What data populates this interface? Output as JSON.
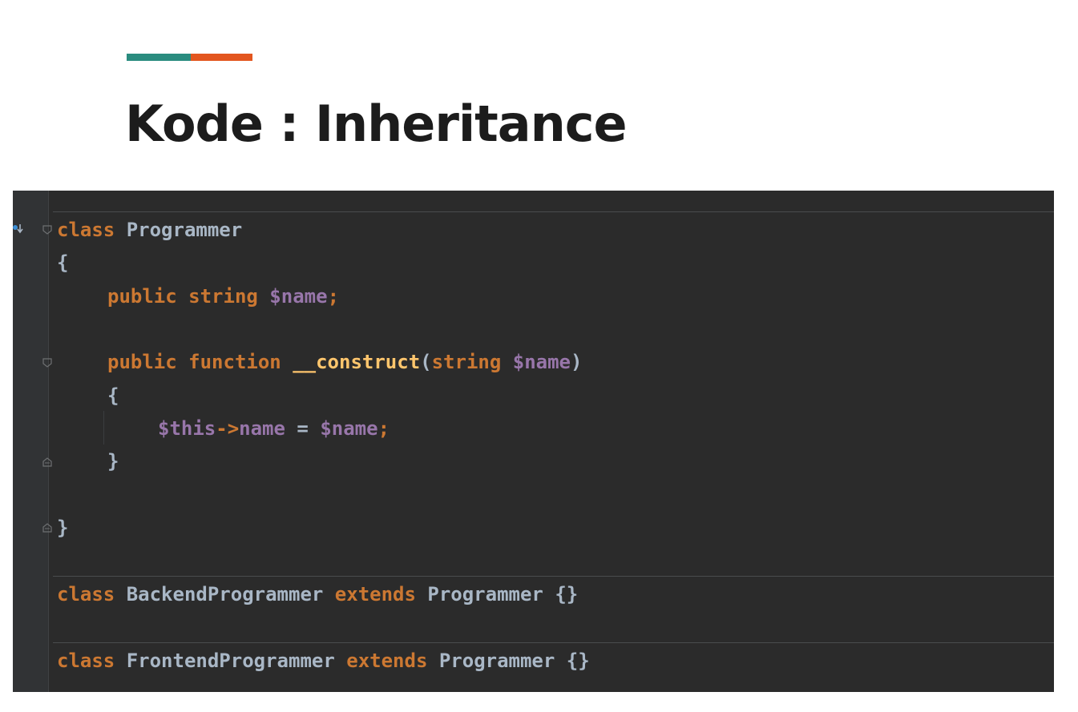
{
  "slide": {
    "title": "Kode : Inheritance",
    "accent_colors": [
      "#2a8c7f",
      "#e3561f"
    ]
  },
  "editor": {
    "theme_colors": {
      "background": "#2b2b2b",
      "keyword": "#cc7832",
      "variable": "#9876aa",
      "function": "#ffc66d",
      "text": "#a9b7c6"
    },
    "lines": {
      "l1": {
        "kw": "class",
        "name": " Programmer"
      },
      "l2": {
        "text": "{"
      },
      "l3": {
        "kw1": "public",
        "kw2": " string",
        "var": " $name",
        "semi": ";"
      },
      "l5": {
        "kw1": "public",
        "kw2": " function",
        "fn": " __construct",
        "p1": "(",
        "kw3": "string",
        "var": " $name",
        "p2": ")"
      },
      "l6": {
        "text": "{"
      },
      "l7": {
        "var1": "$this",
        "arrow": "->",
        "prop": "name",
        "eq": " = ",
        "var2": "$name",
        "semi": ";"
      },
      "l8": {
        "text": "}"
      },
      "l10": {
        "text": "}"
      },
      "l11": {
        "kw1": "class",
        "name1": " BackendProgrammer",
        "kw2": " extends",
        "name2": " Programmer",
        "body": " {}"
      },
      "l12": {
        "kw1": "class",
        "name1": " FrontendProgrammer",
        "kw2": " extends",
        "name2": " Programmer",
        "body": " {}"
      }
    },
    "gutter_icons": [
      "implemented-icon",
      "fold-icon"
    ]
  }
}
